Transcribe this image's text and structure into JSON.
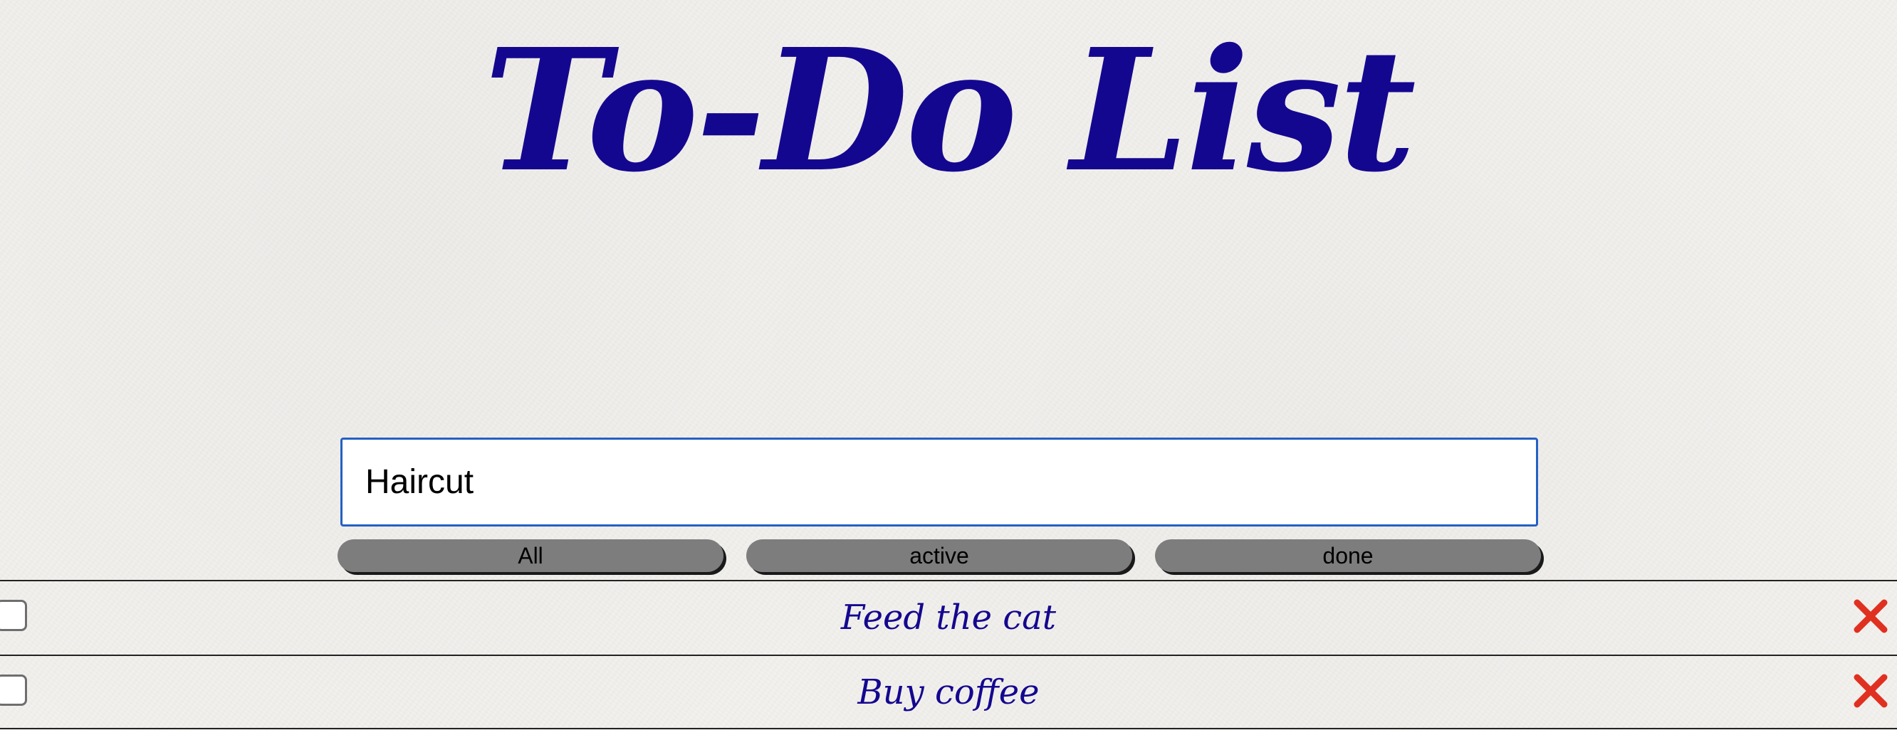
{
  "header": {
    "title": "To-Do List"
  },
  "input": {
    "value": "Haircut"
  },
  "filters": [
    {
      "label": "All"
    },
    {
      "label": "active"
    },
    {
      "label": "done"
    }
  ],
  "todos": [
    {
      "text": "Feed the cat",
      "done": false,
      "delete_icon": "close-icon"
    },
    {
      "text": "Buy coffee",
      "done": false,
      "delete_icon": "close-icon"
    }
  ],
  "colors": {
    "title": "#14078f",
    "item_text": "#14078f",
    "delete": "#e03020",
    "input_border": "#2360c4",
    "button_bg": "#7d7d7d"
  }
}
